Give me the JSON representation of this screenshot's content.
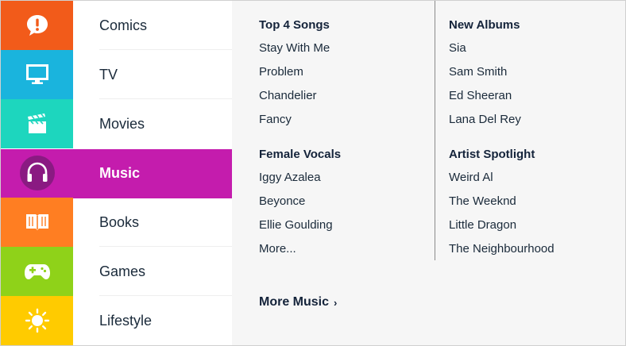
{
  "categories": [
    {
      "label": "Comics",
      "color": "#f25b1a",
      "icon": "speech-bubble-alert-icon"
    },
    {
      "label": "TV",
      "color": "#1ab4dd",
      "icon": "monitor-icon"
    },
    {
      "label": "Movies",
      "color": "#1dd6be",
      "icon": "clapperboard-icon"
    },
    {
      "label": "Music",
      "color": "#c41cad",
      "icon": "headphones-icon"
    },
    {
      "label": "Books",
      "color": "#ff7e22",
      "icon": "open-book-icon"
    },
    {
      "label": "Games",
      "color": "#8fd219",
      "icon": "gamepad-icon"
    },
    {
      "label": "Lifestyle",
      "color": "#ffcb00",
      "icon": "sun-icon"
    }
  ],
  "active_category": "Music",
  "menu": {
    "top_songs": {
      "title": "Top 4 Songs",
      "items": [
        "Stay With Me",
        "Problem",
        "Chandelier",
        "Fancy"
      ]
    },
    "female_vocals": {
      "title": "Female Vocals",
      "items": [
        "Iggy Azalea",
        "Beyonce",
        "Ellie Goulding",
        "More..."
      ]
    },
    "new_albums": {
      "title": "New Albums",
      "items": [
        "Sia",
        "Sam Smith",
        "Ed Sheeran",
        "Lana Del Rey"
      ]
    },
    "artist_spotlight": {
      "title": "Artist Spotlight",
      "items": [
        "Weird Al",
        "The Weeknd",
        "Little Dragon",
        "The Neighbourhood"
      ]
    },
    "more_link": "More Music",
    "more_chevron": "›"
  }
}
